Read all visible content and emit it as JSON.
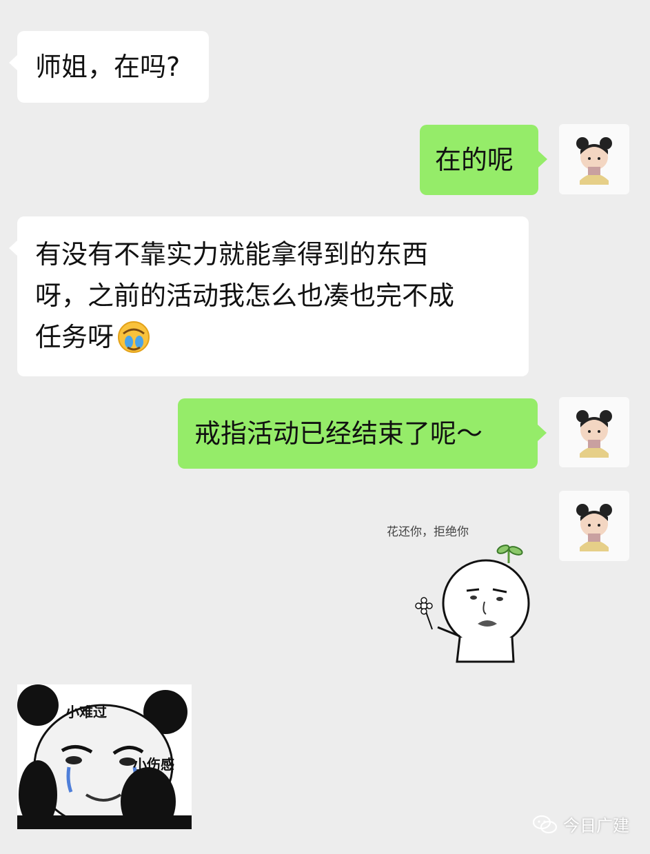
{
  "messages": [
    {
      "side": "left",
      "text": "师姐，在吗?"
    },
    {
      "side": "right",
      "text": "在的呢"
    },
    {
      "side": "left",
      "lines": [
        "有没有不靠实力就能拿得到的东西",
        "呀，之前的活动我怎么也凑也完不成",
        "任务呀"
      ],
      "emoji": "facepalm-crying-emoji"
    },
    {
      "side": "right",
      "text": "戒指活动已经结束了呢～"
    }
  ],
  "stickers": {
    "flower_meme": {
      "caption": "花还你，拒绝你"
    },
    "panda_meme": {
      "label_top": "小难过",
      "label_side": "小伤感"
    }
  },
  "watermark": {
    "text": "今日广建",
    "icon": "wechat-icon"
  },
  "colors": {
    "background": "#ededed",
    "incoming_bubble": "#ffffff",
    "outgoing_bubble": "#95ec69"
  }
}
